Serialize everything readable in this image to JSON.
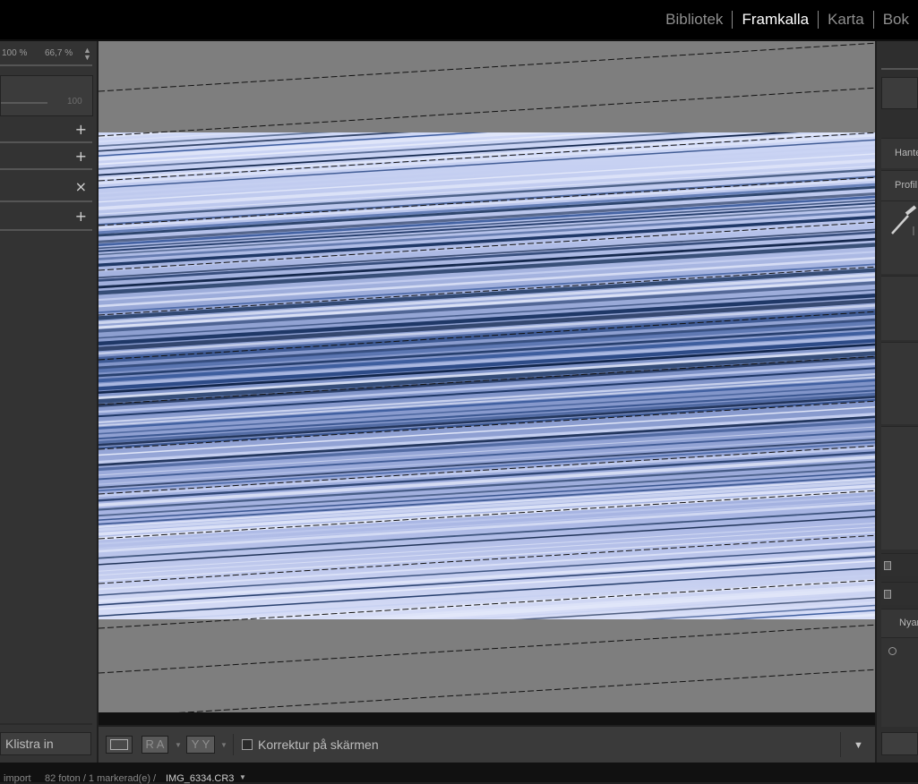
{
  "modules": {
    "items": [
      "Bibliotek",
      "Framkalla",
      "Karta",
      "Bok"
    ],
    "active": "Framkalla"
  },
  "navigator": {
    "zoom_fit": "100 %",
    "zoom_level": "66,7 %",
    "slider_value": "100"
  },
  "left_panel": {
    "controls": [
      "+",
      "+",
      "×",
      "+"
    ],
    "paste_button": "Klistra in"
  },
  "toolbar": {
    "view_before_after_1": "R A",
    "view_before_after_2": "Y Y",
    "soft_proofing_label": "Korrektur på skärmen",
    "soft_proofing_checked": false
  },
  "right_panel": {
    "treatment_label": "Hante",
    "profile_label": "Profil :",
    "preset_label": "Nyar"
  },
  "statusbar": {
    "source": "import",
    "count": "82 foton / 1 markerad(e) /",
    "filename": "IMG_6334.CR3"
  },
  "colors": {
    "background": "#7e7e7e",
    "image_light": "#d6dcf5",
    "image_dark": "#0e2247",
    "active_module": "#ffffff"
  }
}
